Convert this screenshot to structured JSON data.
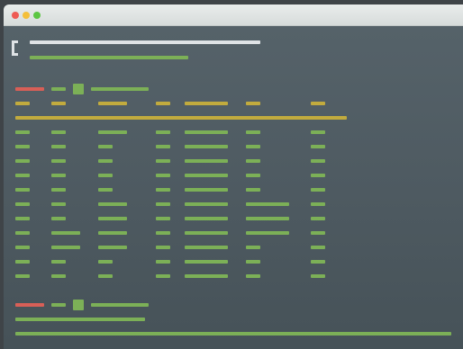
{
  "colors": {
    "close": "#ee5a54",
    "min": "#f4bf3a",
    "max": "#5cc643",
    "white": "#dfe3e6",
    "green": "#7cb057",
    "yellow": "#c2ab3e",
    "red": "#d85f57"
  },
  "window": {
    "buttons": [
      "close",
      "minimize",
      "maximize"
    ]
  },
  "terminal": {
    "header_line": "placeholder-bar",
    "subheader_line": "placeholder-bar",
    "blocks": 2,
    "table_rows": 11
  }
}
